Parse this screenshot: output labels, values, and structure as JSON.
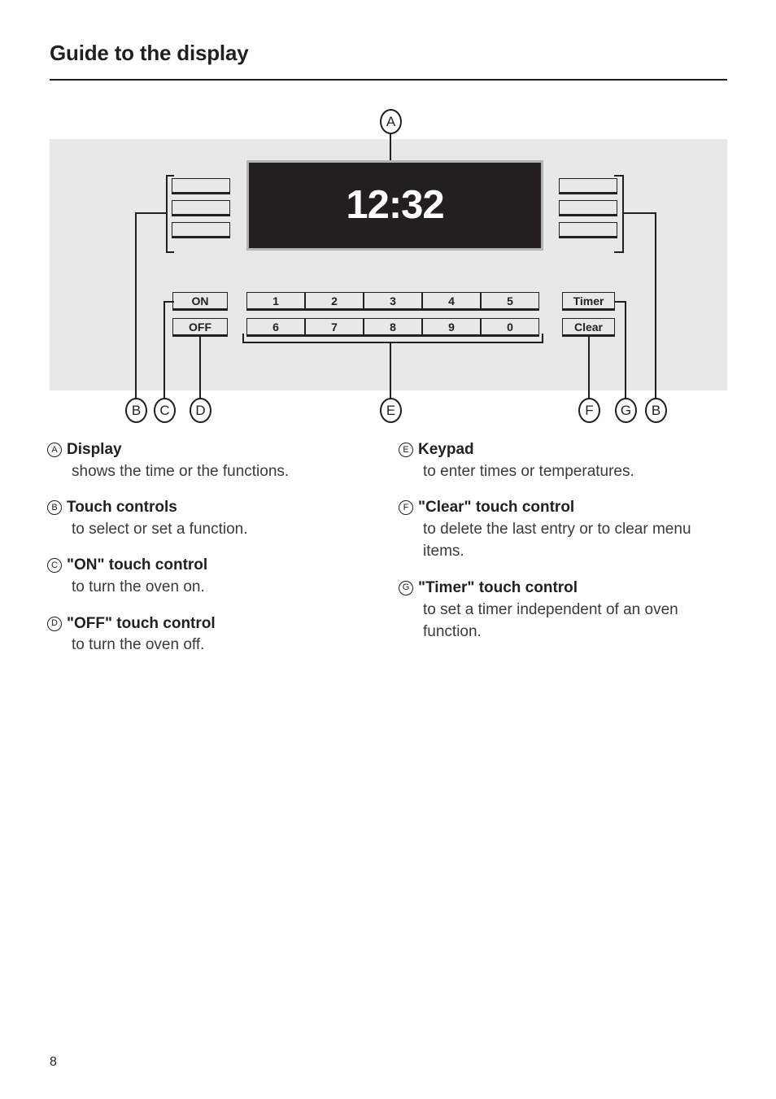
{
  "page": {
    "title": "Guide to the display",
    "number": "8"
  },
  "diagram": {
    "display": {
      "time": "12:32"
    },
    "touch_controls_left": [
      "",
      "",
      ""
    ],
    "touch_controls_right": [
      "",
      "",
      ""
    ],
    "power_buttons": [
      {
        "label": "ON"
      },
      {
        "label": "OFF"
      }
    ],
    "keypad_row_1": [
      "1",
      "2",
      "3",
      "4",
      "5"
    ],
    "keypad_row_2": [
      "6",
      "7",
      "8",
      "9",
      "0"
    ],
    "function_buttons": [
      {
        "label": "Timer"
      },
      {
        "label": "Clear"
      }
    ],
    "callouts": [
      {
        "letter": "A"
      },
      {
        "letter": "B"
      },
      {
        "letter": "C"
      },
      {
        "letter": "D"
      },
      {
        "letter": "E"
      },
      {
        "letter": "F"
      },
      {
        "letter": "G"
      },
      {
        "letter": "B"
      }
    ]
  },
  "descriptions": {
    "left": [
      {
        "marker": "A",
        "title": "Display",
        "body": "shows the time or the functions."
      },
      {
        "marker": "B",
        "title": "Touch controls",
        "body": "to select or set a function."
      },
      {
        "marker": "C",
        "title": "\"ON\" touch control",
        "body": "to turn the oven on."
      },
      {
        "marker": "D",
        "title": "\"OFF\" touch control",
        "body": "to turn the oven off."
      }
    ],
    "right": [
      {
        "marker": "E",
        "title": "Keypad",
        "body": "to enter times or temperatures."
      },
      {
        "marker": "F",
        "title": "\"Clear\" touch control",
        "body": "to delete the last entry or to clear menu items."
      },
      {
        "marker": "G",
        "title": "\"Timer\" touch control",
        "body": "to set a timer independent of an oven function."
      }
    ]
  },
  "colors": {
    "panel_background": "#e8e8e8",
    "display_background": "#231f20",
    "display_text": "#ffffff",
    "ink": "#231f20"
  }
}
